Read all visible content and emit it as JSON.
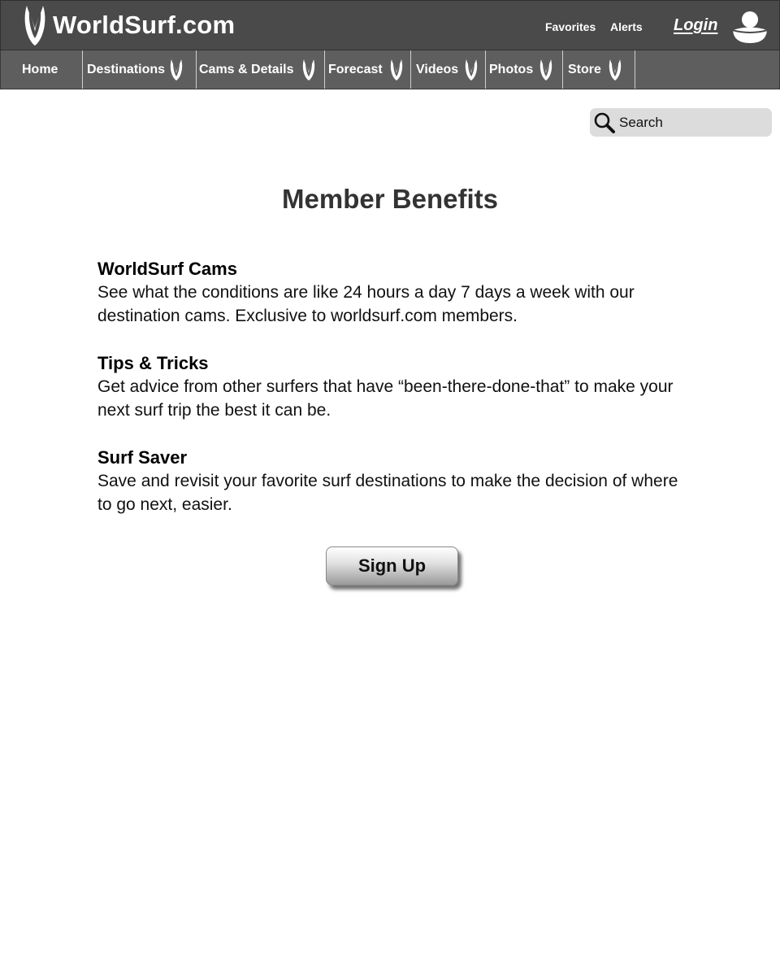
{
  "header": {
    "logo_text": "WorldSurf.com",
    "favorites_label": "Favorites",
    "alerts_label": "Alerts",
    "login_label": "Login",
    "user_icon": "user-icon"
  },
  "nav": {
    "items": [
      {
        "label": "Home",
        "has_dropdown": false
      },
      {
        "label": "Destinations",
        "has_dropdown": true
      },
      {
        "label": "Cams & Details",
        "has_dropdown": true
      },
      {
        "label": "Forecast",
        "has_dropdown": true
      },
      {
        "label": "Videos",
        "has_dropdown": true
      },
      {
        "label": "Photos",
        "has_dropdown": true
      },
      {
        "label": "Store",
        "has_dropdown": true
      }
    ],
    "dropdown_icon": "surfboard-icon"
  },
  "search": {
    "placeholder": "Search",
    "icon": "search-icon"
  },
  "main": {
    "title": "Member Benefits",
    "benefits": [
      {
        "title": "WorldSurf Cams",
        "description": "See what the conditions are like 24 hours a day 7 days a week with our destination cams. Exclusive to worldsurf.com members."
      },
      {
        "title": "Tips & Tricks",
        "description": "Get advice from other surfers that have “been-there-done-that” to make your next surf trip the best it can be."
      },
      {
        "title": "Surf Saver",
        "description": "Save and revisit your favorite surf destinations to make the decision of where to go next, easier."
      }
    ],
    "signup_label": "Sign Up"
  },
  "colors": {
    "header_bg": "#4a4a4b",
    "nav_bg": "#5e5e5f",
    "search_bg": "#dcdcdc",
    "title_color": "#333333"
  }
}
